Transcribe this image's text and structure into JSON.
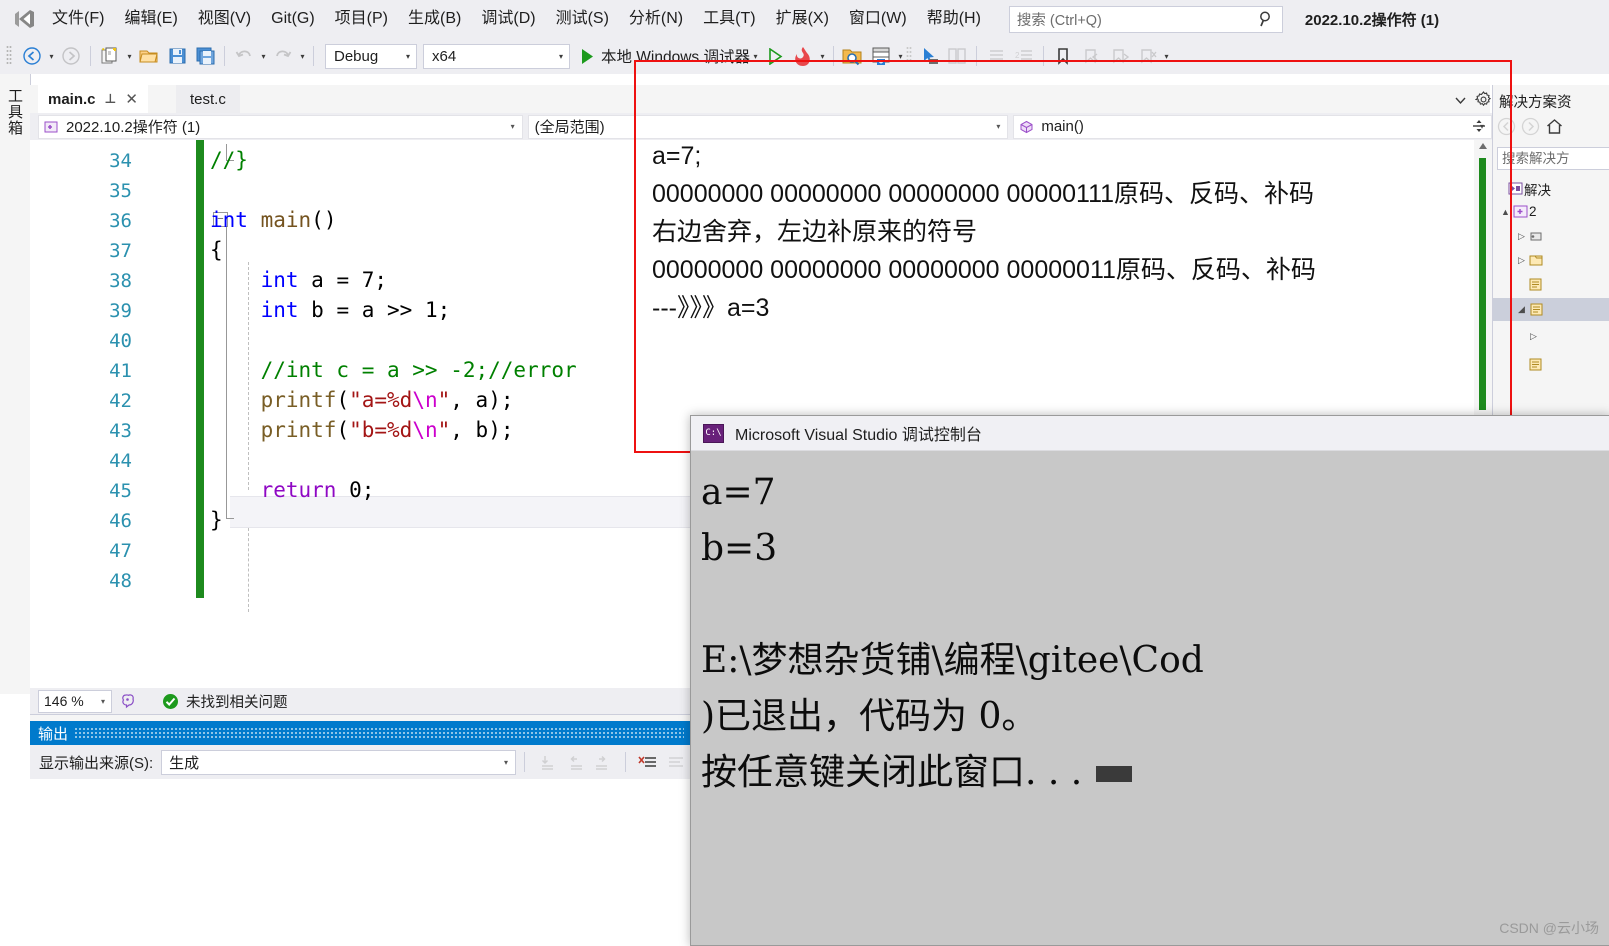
{
  "app": {
    "window_title": "2022.10.2操作符 (1)",
    "logo_name": "visual-studio-logo"
  },
  "menubar": {
    "items": [
      {
        "label": "文件(F)",
        "name": "menu-file"
      },
      {
        "label": "编辑(E)",
        "name": "menu-edit"
      },
      {
        "label": "视图(V)",
        "name": "menu-view"
      },
      {
        "label": "Git(G)",
        "name": "menu-git"
      },
      {
        "label": "项目(P)",
        "name": "menu-project"
      },
      {
        "label": "生成(B)",
        "name": "menu-build"
      },
      {
        "label": "调试(D)",
        "name": "menu-debug"
      },
      {
        "label": "测试(S)",
        "name": "menu-test"
      },
      {
        "label": "分析(N)",
        "name": "menu-analyze"
      },
      {
        "label": "工具(T)",
        "name": "menu-tools"
      },
      {
        "label": "扩展(X)",
        "name": "menu-extensions"
      },
      {
        "label": "窗口(W)",
        "name": "menu-window"
      },
      {
        "label": "帮助(H)",
        "name": "menu-help"
      }
    ],
    "search_placeholder": "搜索 (Ctrl+Q)"
  },
  "toolbar": {
    "configuration": "Debug",
    "platform": "x64",
    "run_label": "本地 Windows 调试器"
  },
  "toolbox": {
    "label": "工具箱"
  },
  "tabs": [
    {
      "label": "main.c",
      "name": "tab-main-c",
      "active": true
    },
    {
      "label": "test.c",
      "name": "tab-test-c",
      "active": false
    }
  ],
  "navbar": {
    "project": "2022.10.2操作符 (1)",
    "scope": "(全局范围)",
    "member": "main()"
  },
  "editor": {
    "first_line": 34,
    "lines": [
      {
        "num": 34,
        "text": "//}"
      },
      {
        "num": 35,
        "text": ""
      },
      {
        "num": 36,
        "text": "int main()"
      },
      {
        "num": 37,
        "text": "{"
      },
      {
        "num": 38,
        "text": "    int a = 7;"
      },
      {
        "num": 39,
        "text": "    int b = a >> 1;"
      },
      {
        "num": 40,
        "text": ""
      },
      {
        "num": 41,
        "text": "    //int c = a >> -2;//error"
      },
      {
        "num": 42,
        "text": "    printf(\"a=%d\\n\", a);"
      },
      {
        "num": 43,
        "text": "    printf(\"b=%d\\n\", b);"
      },
      {
        "num": 44,
        "text": ""
      },
      {
        "num": 45,
        "text": "    return 0;"
      },
      {
        "num": 46,
        "text": "}"
      },
      {
        "num": 47,
        "text": ""
      },
      {
        "num": 48,
        "text": ""
      }
    ]
  },
  "annotation": {
    "lines": [
      "a=7;",
      "00000000 00000000 00000000 00000111原码、反码、补码",
      "右边舍弃，左边补原来的符号",
      "00000000 00000000 00000000 00000011原码、反码、补码",
      "---》》》a=3"
    ],
    "box_color": "#ee1111"
  },
  "statusbar": {
    "zoom": "146 %",
    "issue_text": "未找到相关问题"
  },
  "output_panel": {
    "title": "输出",
    "source_label": "显示输出来源(S):",
    "source_value": "生成"
  },
  "solution_explorer": {
    "title": "解决方案资",
    "search_placeholder": "搜索解决方",
    "tree": [
      {
        "label": "解决",
        "indent": 0,
        "icon": "solution-icon",
        "expander": ""
      },
      {
        "label": "2",
        "indent": 1,
        "icon": "project-icon",
        "expander": "▲"
      },
      {
        "label": "",
        "indent": 2,
        "icon": "references-icon",
        "expander": "▷"
      },
      {
        "label": "",
        "indent": 2,
        "icon": "folder-icon",
        "expander": "▷"
      },
      {
        "label": "",
        "indent": 3,
        "icon": "file-icon",
        "expander": ""
      },
      {
        "label": "",
        "indent": 2,
        "icon": "file-icon",
        "expander": "◢",
        "selected": true
      },
      {
        "label": "",
        "indent": 3,
        "icon": "file-icon",
        "expander": "▷"
      },
      {
        "label": "",
        "indent": 3,
        "icon": "file-icon",
        "expander": ""
      }
    ]
  },
  "console": {
    "title": "Microsoft Visual Studio 调试控制台",
    "lines": [
      "a=7",
      "b=3",
      "",
      "E:\\梦想杂货铺\\编程\\gitee\\Cod",
      ")已退出，代码为 0。",
      "按任意键关闭此窗口. . ."
    ]
  },
  "watermark": "CSDN @云小场"
}
